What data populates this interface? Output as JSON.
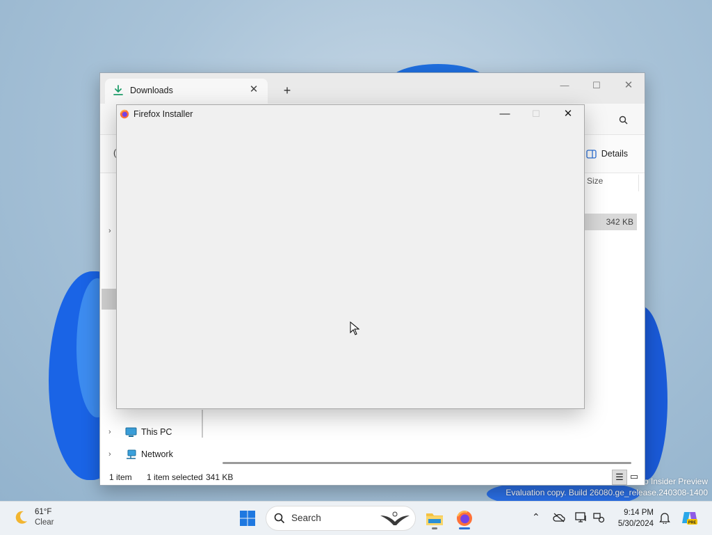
{
  "watermark": {
    "line1": "ro Insider Preview",
    "line2": "Evaluation copy. Build 26080.ge_release.240308-1400"
  },
  "explorer": {
    "tab_label": "Downloads",
    "tab_icon": "download-icon",
    "new_tab_symbol": "+",
    "details_label": "Details",
    "column_size": "Size",
    "selected_size": "342 KB",
    "nav": {
      "this_pc": "This PC",
      "network": "Network"
    },
    "status": {
      "count": "1 item",
      "selected": "1 item selected",
      "size": "341 KB"
    }
  },
  "installer": {
    "title": "Firefox Installer",
    "icon": "firefox-icon"
  },
  "taskbar": {
    "weather": {
      "temp": "61°F",
      "condition": "Clear"
    },
    "search_placeholder": "Search",
    "time": "9:14 PM",
    "date": "5/30/2024"
  },
  "colors": {
    "accent": "#2b6fd6",
    "desktop_bg": "#a9c3d8",
    "installer_bg": "#f0f0f0"
  }
}
